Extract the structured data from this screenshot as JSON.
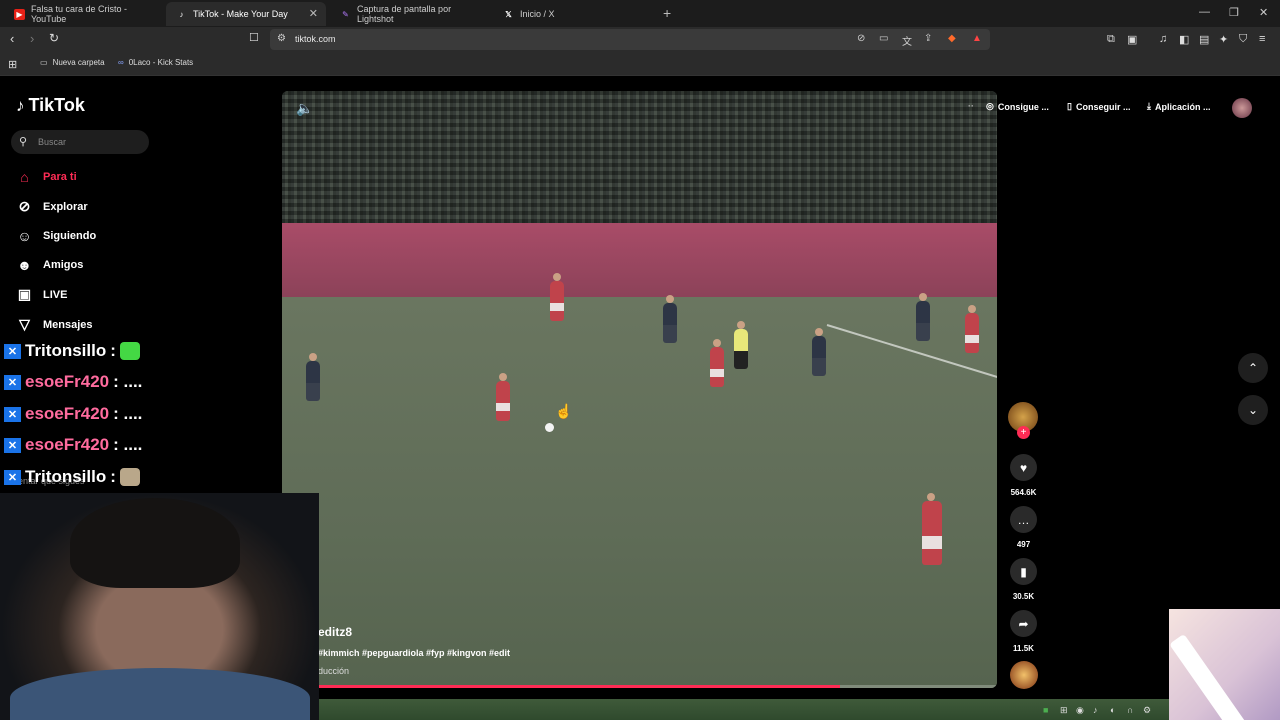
{
  "browser": {
    "tabs": [
      {
        "title": "Falsa tu cara de Cristo - YouTube",
        "icon": "youtube-icon",
        "active": false
      },
      {
        "title": "TikTok - Make Your Day",
        "icon": "tiktok-icon",
        "active": true
      },
      {
        "title": "Captura de pantalla por Lightshot",
        "icon": "lightshot-icon",
        "active": false
      },
      {
        "title": "Inicio / X",
        "icon": "x-icon",
        "active": false
      }
    ],
    "url": "tiktok.com",
    "bookmarks": [
      {
        "label": "Nueva carpeta",
        "icon": "folder-icon"
      },
      {
        "label": "0Laco - Kick Stats",
        "icon": "kick-icon"
      }
    ],
    "brave_badge": "1"
  },
  "tiktok": {
    "logo": "TikTok",
    "search_placeholder": "Buscar",
    "nav": [
      {
        "label": "Para ti",
        "icon": "home-icon",
        "active": true
      },
      {
        "label": "Explorar",
        "icon": "compass-icon",
        "active": false
      },
      {
        "label": "Siguiendo",
        "icon": "following-icon",
        "active": false
      },
      {
        "label": "Amigos",
        "icon": "friends-icon",
        "active": false
      },
      {
        "label": "LIVE",
        "icon": "live-icon",
        "active": false
      },
      {
        "label": "Mensajes",
        "icon": "messages-icon",
        "active": false
      }
    ],
    "header": {
      "btn1": "Consigue ...",
      "btn2": "Conseguir ...",
      "btn3": "Aplicación ..."
    },
    "video": {
      "author": "editz8",
      "description": "#kimmich #pepguardiola #fyp #kingvon #edit",
      "music": "ducción",
      "progress": 0.78
    },
    "actions": {
      "likes": "564.6K",
      "comments": "497",
      "saves": "30.5K",
      "shares": "11.5K"
    }
  },
  "chat_overlay": [
    {
      "name": "Tritonsillo",
      "suffix": ":",
      "pink": false,
      "emote": "green"
    },
    {
      "name": "esoeFr420",
      "suffix": ": ....",
      "pink": true,
      "emote": null
    },
    {
      "name": "esoeFr420",
      "suffix": ": ....",
      "pink": true,
      "emote": null
    },
    {
      "name": "esoeFr420",
      "suffix": ": ....",
      "pink": true,
      "emote": null
    },
    {
      "name": "Tritonsillo",
      "suffix": ":",
      "pink": false,
      "emote": "picture"
    }
  ],
  "colors": {
    "accent": "#fe2c55",
    "chat_tag": "#1a73e8",
    "chat_pink": "#ff6b9e"
  }
}
